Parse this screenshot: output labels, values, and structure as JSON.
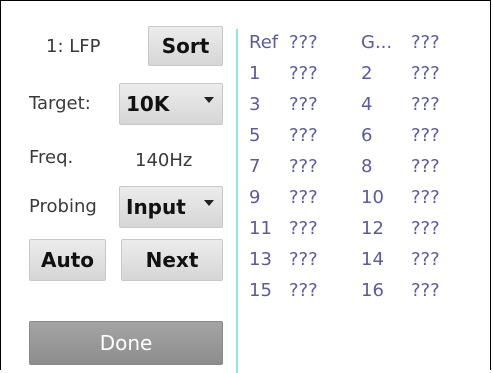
{
  "left_panel": {
    "channel_label": "1: LFP",
    "sort_button": "Sort",
    "target_label": "Target:",
    "target_value": "10K",
    "freq_label": "Freq.",
    "freq_value": "140Hz",
    "probing_label": "Probing",
    "probing_value": "Input",
    "auto_button": "Auto",
    "next_button": "Next",
    "done_button": "Done"
  },
  "table": {
    "headers": [
      "Ref",
      "???",
      "G...",
      "???"
    ],
    "rows": [
      [
        "1",
        "???",
        "2",
        "???"
      ],
      [
        "3",
        "???",
        "4",
        "???"
      ],
      [
        "5",
        "???",
        "6",
        "???"
      ],
      [
        "7",
        "???",
        "8",
        "???"
      ],
      [
        "9",
        "???",
        "10",
        "???"
      ],
      [
        "11",
        "???",
        "12",
        "???"
      ],
      [
        "13",
        "???",
        "14",
        "???"
      ],
      [
        "15",
        "???",
        "16",
        "???"
      ]
    ]
  },
  "colors": {
    "divider": "#8ee6ea",
    "table_text": "#5b5aa1",
    "done_button_bg": "#999999"
  }
}
